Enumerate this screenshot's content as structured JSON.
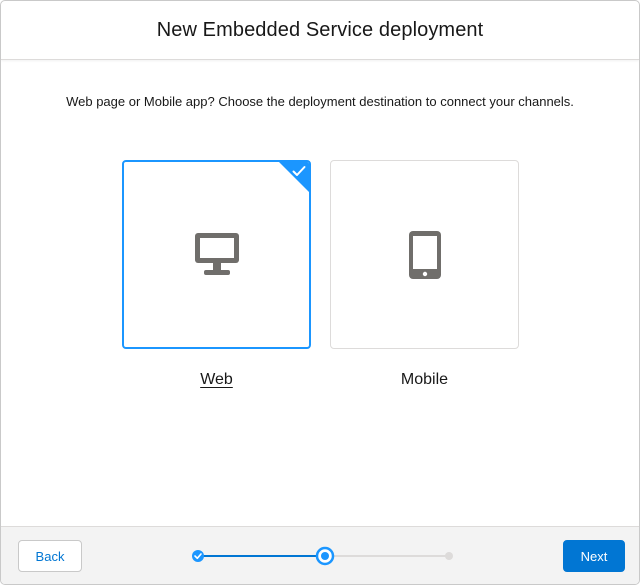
{
  "header": {
    "title": "New Embedded Service deployment"
  },
  "body": {
    "instruction": "Web page or Mobile app? Choose the deployment destination to connect your channels.",
    "options": [
      {
        "label": "Web",
        "icon": "desktop-icon",
        "selected": true
      },
      {
        "label": "Mobile",
        "icon": "mobile-icon",
        "selected": false
      }
    ]
  },
  "footer": {
    "back_label": "Back",
    "next_label": "Next",
    "progress": {
      "total_steps": 3,
      "current_step": 2,
      "completed_steps": 1
    }
  },
  "colors": {
    "brand": "#0176d3",
    "selected_border": "#1b96ff",
    "icon_gray": "#706e6b",
    "progress_track": "#dddbda"
  }
}
